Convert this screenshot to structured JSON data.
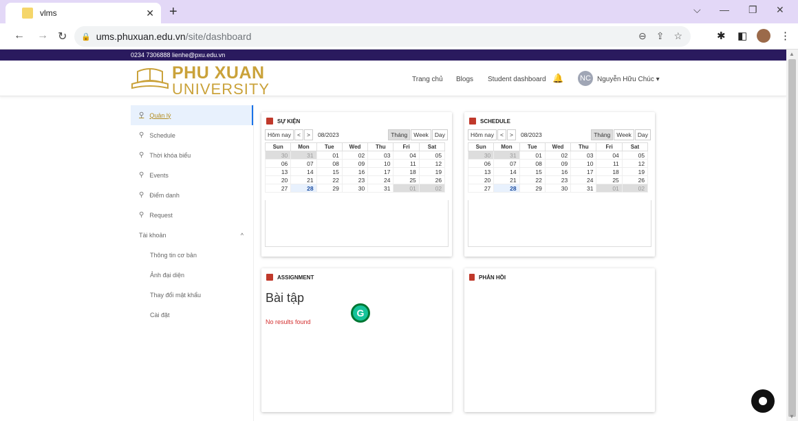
{
  "browser": {
    "tab_title": "vlms",
    "url_host": "ums.phuxuan.edu.vn",
    "url_path": "/site/dashboard"
  },
  "topbar": {
    "contact": "0234 7306888  lienhe@pxu.edu.vn"
  },
  "logo": {
    "line1": "PHU XUAN",
    "line2": "UNIVERSITY"
  },
  "nav": {
    "home": "Trang chủ",
    "blogs": "Blogs",
    "student": "Student dashboard",
    "user_initials": "NC",
    "user_name": "Nguyễn Hữu Chúc"
  },
  "sidebar": {
    "items": [
      "Quản lý",
      "Schedule",
      "Thời khóa biểu",
      "Events",
      "Điểm danh",
      "Request"
    ],
    "account": "Tài khoản",
    "sub": [
      "Thông tin cơ bản",
      "Ảnh đại diện",
      "Thay đổi mật khẩu",
      "Cài đặt"
    ]
  },
  "events": {
    "title": "SỰ KIỆN"
  },
  "schedule": {
    "title": "SCHEDULE"
  },
  "calendar": {
    "today": "Hôm nay",
    "prev": "<",
    "next": ">",
    "month": "08/2023",
    "views": [
      "Tháng",
      "Week",
      "Day"
    ],
    "weekdays": [
      "Sun",
      "Mon",
      "Tue",
      "Wed",
      "Thu",
      "Fri",
      "Sat"
    ],
    "weeks": [
      [
        "30",
        "31",
        "01",
        "02",
        "03",
        "04",
        "05"
      ],
      [
        "06",
        "07",
        "08",
        "09",
        "10",
        "11",
        "12"
      ],
      [
        "13",
        "14",
        "15",
        "16",
        "17",
        "18",
        "19"
      ],
      [
        "20",
        "21",
        "22",
        "23",
        "24",
        "25",
        "26"
      ],
      [
        "27",
        "28",
        "29",
        "30",
        "31",
        "01",
        "02"
      ]
    ]
  },
  "assignment": {
    "title": "ASSIGNMENT",
    "heading": "Bài tập",
    "empty": "No results found"
  },
  "feedback": {
    "title": "PHẢN HỒI"
  },
  "colors": {
    "accent": "#1a73e8",
    "brand_gold": "#caa23a",
    "topstrip": "#2a1a5e",
    "icon_red": "#c0392b"
  }
}
